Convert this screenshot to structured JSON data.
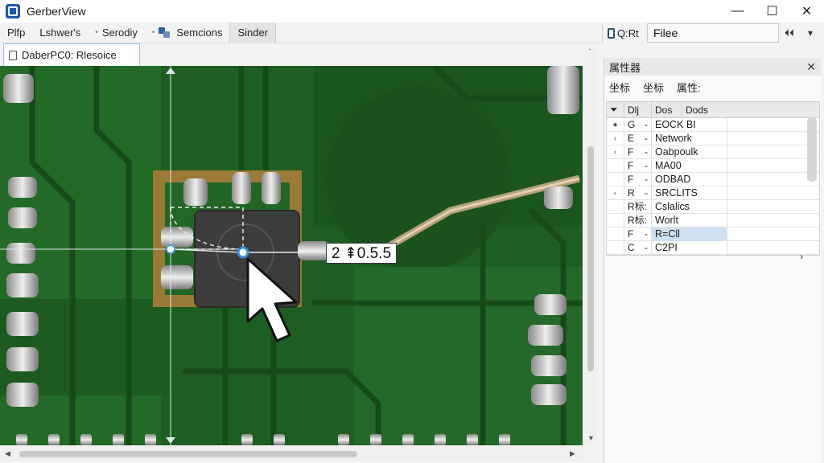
{
  "window": {
    "title": "GerberView",
    "controls": [
      "—",
      "☐",
      "✕"
    ]
  },
  "menu": {
    "items": [
      "Plfp",
      "Lshwer's",
      "Serodiy",
      "Semcions",
      "Sinder"
    ]
  },
  "right_toolbar": {
    "qrt_label": "Q:Rt",
    "file_value": "Filee",
    "btn1": "⏴⏴",
    "btn2": "▾"
  },
  "doc_tab": {
    "label": "DaberPC0: Rlesoice"
  },
  "canvas": {
    "measurement": "2 ⇞0.5.5"
  },
  "panel": {
    "title": "属性器",
    "tabs": [
      "坐标",
      "坐标",
      "属性:"
    ],
    "columns": [
      "Dlj",
      "Dos",
      "Dods"
    ],
    "rows": [
      {
        "mark": "●",
        "a": "G",
        "b": "-",
        "name": "EOCK BI"
      },
      {
        "mark": "‹",
        "a": "E",
        "b": "-",
        "name": "Network"
      },
      {
        "mark": "‹",
        "a": "F",
        "b": "-",
        "name": "Oabpoulk"
      },
      {
        "mark": "",
        "a": "F",
        "b": "-",
        "name": "MA00"
      },
      {
        "mark": "",
        "a": "F",
        "b": "-",
        "name": "ODBAD"
      },
      {
        "mark": "‹",
        "a": "R",
        "b": "-",
        "name": "SRCLITS"
      },
      {
        "mark": "",
        "a": "R标:",
        "b": "",
        "name": "Cslalics"
      },
      {
        "mark": "",
        "a": "R标:",
        "b": "",
        "name": "Worlt"
      },
      {
        "mark": "",
        "a": "F",
        "b": "-",
        "name": "R=Cll"
      },
      {
        "mark": "",
        "a": "C",
        "b": "-",
        "name": "C2PI"
      }
    ],
    "selected_row": 8
  },
  "colors": {
    "pcb_green": "#1f5e22",
    "accent": "#1e5aa8"
  }
}
